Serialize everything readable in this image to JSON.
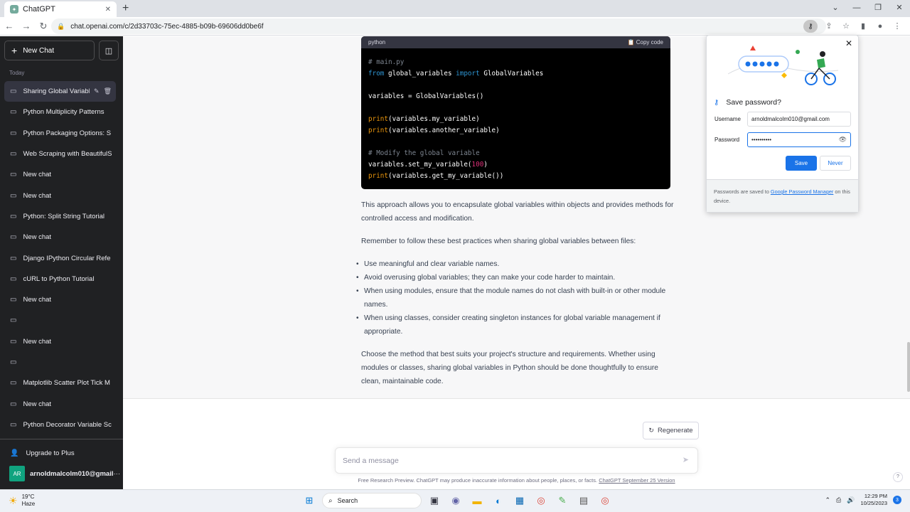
{
  "browser": {
    "tab_title": "ChatGPT",
    "url": "chat.openai.com/c/2d33703c-75ec-4885-b09b-69606dd0be6f"
  },
  "sidebar": {
    "new_chat_label": "New Chat",
    "section_label": "Today",
    "items": [
      {
        "label": "Sharing Global Variabl"
      },
      {
        "label": "Python Multiplicity Patterns"
      },
      {
        "label": "Python Packaging Options: S"
      },
      {
        "label": "Web Scraping with BeautifulS"
      },
      {
        "label": "New chat"
      },
      {
        "label": "New chat"
      },
      {
        "label": "Python: Split String Tutorial"
      },
      {
        "label": "New chat"
      },
      {
        "label": "Django IPython Circular Refe"
      },
      {
        "label": "cURL to Python Tutorial"
      },
      {
        "label": "New chat"
      },
      {
        "label": ""
      },
      {
        "label": "New chat"
      },
      {
        "label": ""
      },
      {
        "label": "Matplotlib Scatter Plot Tick M"
      },
      {
        "label": "New chat"
      },
      {
        "label": "Python Decorator Variable Sc"
      }
    ],
    "upgrade_label": "Upgrade to Plus",
    "avatar_initials": "AR",
    "username": "arnoldmalcolm010@gmail.com"
  },
  "code": {
    "language": "python",
    "copy_label": "Copy code",
    "lines": {
      "l1": "# main.py",
      "l2_from": "from",
      "l2_mod": " global_variables ",
      "l2_import": "import",
      "l2_cls": " GlobalVariables",
      "l4": "variables = GlobalVariables()",
      "print": "print",
      "l6_rest": "(variables.my_variable)",
      "l7_rest": "(variables.another_variable)",
      "l9": "# Modify the global variable",
      "l10_a": "variables.set_my_variable(",
      "l10_num": "100",
      "l10_b": ")",
      "l11_rest": "(variables.get_my_variable())"
    }
  },
  "response": {
    "p1": "This approach allows you to encapsulate global variables within objects and provides methods for controlled access and modification.",
    "p2": "Remember to follow these best practices when sharing global variables between files:",
    "bullets": [
      "Use meaningful and clear variable names.",
      "Avoid overusing global variables; they can make your code harder to maintain.",
      "When using modules, ensure that the module names do not clash with built-in or other module names.",
      "When using classes, consider creating singleton instances for global variable management if appropriate."
    ],
    "p3": "Choose the method that best suits your project's structure and requirements. Whether using modules or classes, sharing global variables in Python should be done thoughtfully to ensure clean, maintainable code."
  },
  "composer": {
    "regenerate_label": "Regenerate",
    "placeholder": "Send a message",
    "disclaimer": "Free Research Preview. ChatGPT may produce inaccurate information about people, places, or facts.",
    "version_link": "ChatGPT September 25 Version",
    "help": "?"
  },
  "password_popup": {
    "title": "Save password?",
    "username_label": "Username",
    "username_value": "arnoldmalcolm010@gmail.com",
    "password_label": "Password",
    "password_value": "••••••••••",
    "save_label": "Save",
    "never_label": "Never",
    "footer_prefix": "Passwords are saved to ",
    "footer_link": "Google Password Manager",
    "footer_suffix": " on this device."
  },
  "taskbar": {
    "temperature": "19°C",
    "weather": "Haze",
    "search_label": "Search",
    "time": "12:29 PM",
    "date": "10/25/2023",
    "notifications": "3"
  },
  "colors": {
    "sidebar_bg": "#202123",
    "accent": "#10a37f",
    "chrome_blue": "#1a73e8"
  }
}
